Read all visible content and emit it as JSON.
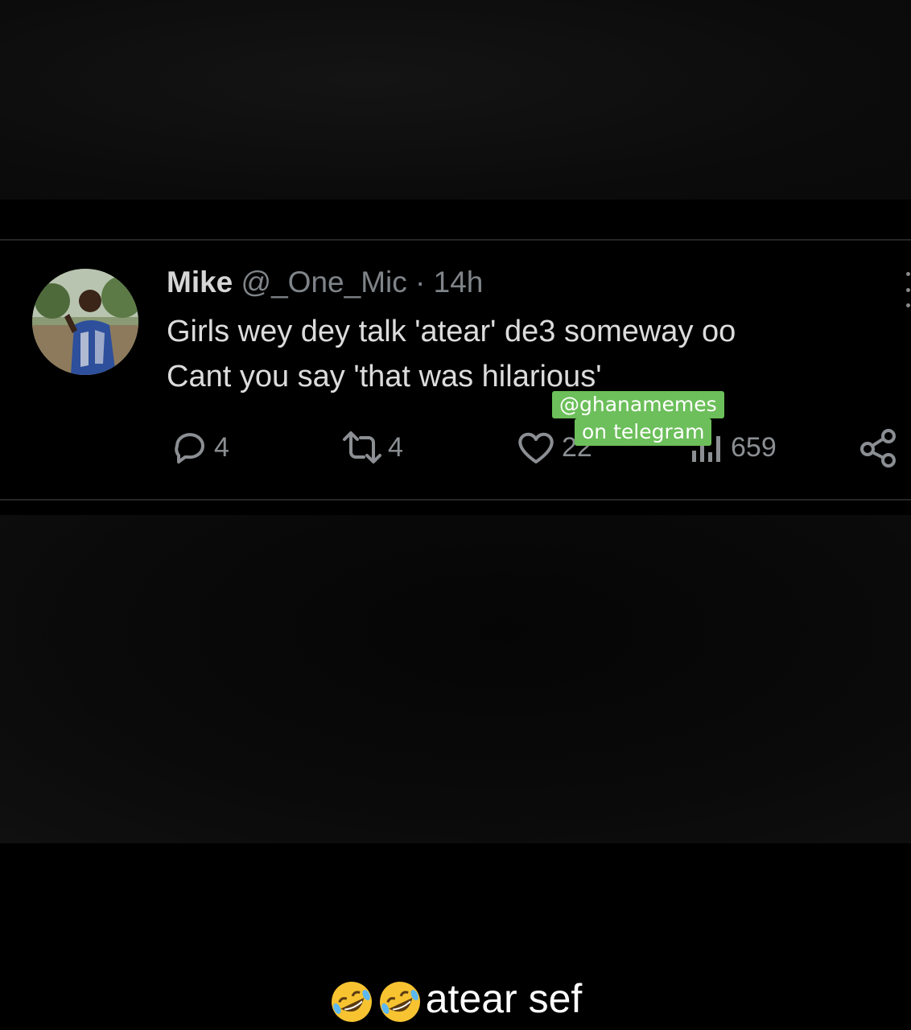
{
  "tweet": {
    "name": "Mike",
    "handle": "@_One_Mic",
    "separator": "·",
    "time": "14h",
    "lines": [
      "Girls wey dey talk 'atear' de3 someway oo",
      "Cant you say 'that was hilarious'"
    ],
    "actions": {
      "replies": "4",
      "retweets": "4",
      "likes": "22",
      "views": "659"
    }
  },
  "watermark": {
    "line1": "@ghanamemes",
    "line2": "on telegram",
    "color": "#6cbf5a"
  },
  "caption": {
    "emojis": [
      "rolling-on-floor-laughing-emoji",
      "rolling-on-floor-laughing-emoji"
    ],
    "text": "atear sef"
  },
  "colors": {
    "background": "#000000",
    "muted_text": "#7f8489",
    "body_text": "#dcdcdc"
  }
}
